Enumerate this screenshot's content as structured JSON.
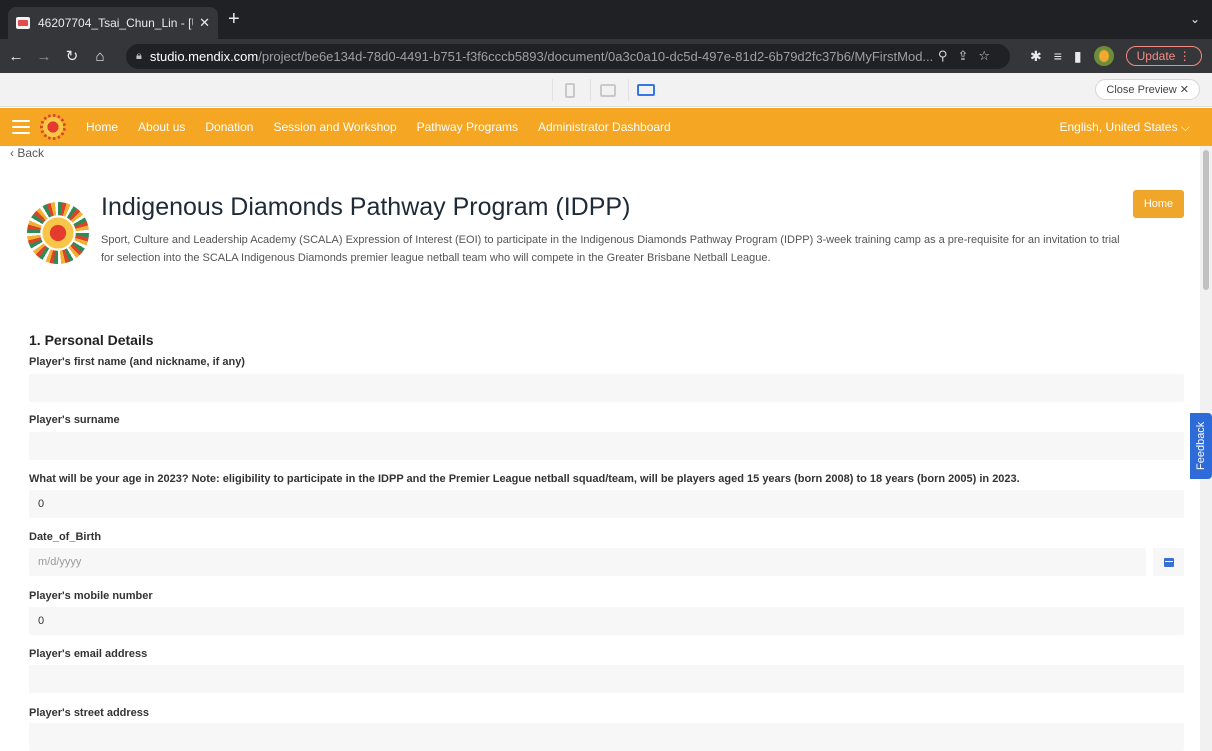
{
  "browser": {
    "tab_title": "46207704_Tsai_Chun_Lin - [U",
    "url_host": "studio.mendix.com",
    "url_path": "/project/be6e134d-78d0-4491-b751-f3f6cccb5893/document/0a3c0a10-dc5d-497e-81d2-6b79d2fc37b6/MyFirstMod...",
    "update_label": "Update"
  },
  "preview": {
    "close_label": "Close Preview ✕"
  },
  "nav": {
    "items": [
      "Home",
      "About us",
      "Donation",
      "Session and Workshop",
      "Pathway Programs",
      "Administrator Dashboard"
    ],
    "language": "English, United States ⌵"
  },
  "page": {
    "back_label": "‹ Back",
    "title": "Indigenous Diamonds Pathway Program (IDPP)",
    "intro": "Sport, Culture and Leadership Academy (SCALA) Expression of Interest (EOI) to participate in the Indigenous Diamonds Pathway Program (IDPP) 3-week training camp as a pre-requisite for an invitation to trial for selection into the SCALA Indigenous Diamonds premier league netball team who will compete in the Greater Brisbane Netball League.",
    "home_button": "Home",
    "section_title": "1. Personal Details",
    "feedback_label": "Feedback"
  },
  "form": {
    "fields": [
      {
        "label": "Player's first name (and nickname, if any)",
        "value": ""
      },
      {
        "label": "Player's surname",
        "value": ""
      },
      {
        "label": "What will be your age in 2023? Note: eligibility to participate in the IDPP and the Premier League netball squad/team, will be players aged 15 years (born 2008) to 18 years (born 2005) in 2023.",
        "value": "0"
      },
      {
        "label": "Date_of_Birth",
        "value": "",
        "placeholder": "m/d/yyyy"
      },
      {
        "label": "Player's mobile number",
        "value": "0"
      },
      {
        "label": "Player's email address",
        "value": ""
      },
      {
        "label": "Player's street address",
        "value": ""
      }
    ]
  },
  "icons": {
    "menu": "hamburger-menu-icon",
    "calendar": "calendar-icon",
    "brand_color": "#f5a623",
    "accent_blue": "#2e6ad8"
  }
}
